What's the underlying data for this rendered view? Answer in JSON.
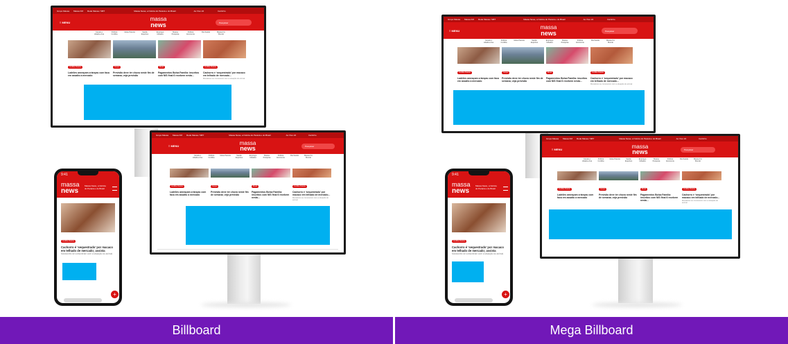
{
  "labels": {
    "left": "Billboard",
    "right": "Mega Billboard"
  },
  "colors": {
    "label_bar": "#7118b8",
    "brand_red": "#d81313",
    "ad_blue": "#00b0f0"
  },
  "site": {
    "top_links": [
      "Grupo Massa",
      "Massa FM",
      "Rede Massa / SBT"
    ],
    "top_center": "Massa News, a Notícia do Paraná e do Brasil",
    "top_right": "Ao Vivo 24",
    "cart": "Carrinho",
    "logo_line1": "massa",
    "logo_line2": "news",
    "menu": "≡ MENU",
    "search_placeholder": "Pesquisar",
    "nav": [
      "Canais e cidades Ana",
      "Política Curitiba",
      "Idosa Paraná",
      "Saúde Esportes",
      "Emprego Cidades",
      "Massa Pesquisa",
      "Política Economia",
      "Dia Saúde",
      "Massa Fm Mundo"
    ],
    "cards": [
      {
        "tag": "Curitiba Paraná",
        "title": "Ladrões ameaçam crianças com faca em assalto a mercado",
        "sub": ""
      },
      {
        "tag": "Tempo",
        "title": "Previsão deve ter chuva neste fim de semana; veja previsão",
        "sub": ""
      },
      {
        "tag": "Brasil",
        "title": "Pagamentos Bolsa Família: inscritos com NIS final 6 recebem nesta...",
        "sub": ""
      },
      {
        "tag": "Curitiba Paraná",
        "title": "Cachorro é ‘sequestrado’ por macaco em telhado de mercado...",
        "sub": "Moradores se comoveram com a situação do animal"
      }
    ]
  },
  "phone": {
    "time": "9:41",
    "header_text": "Massa News, a Notícia do Paraná e do Brasil",
    "tag": "Curitiba Paraná",
    "title": "Cachorro é ‘sequestrado’ por macaco em telhado de mercado; assista",
    "sub": "Moradores se comoveram com a situação do animal",
    "fab": "+"
  }
}
